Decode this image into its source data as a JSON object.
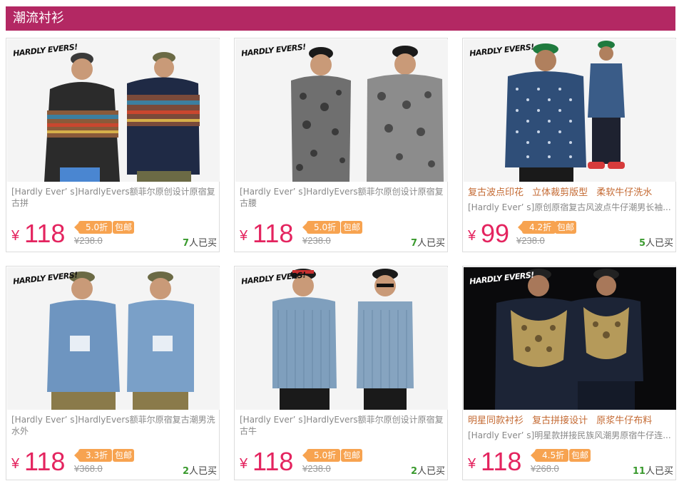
{
  "header": {
    "title": "潮流衬衫"
  },
  "brand": {
    "logo_text": "HARDLY EVERS!"
  },
  "products": [
    {
      "title": "[Hardly Ever’ s]HardlyEvers额菲尔原创设计原宿复古拼",
      "price": "118",
      "currency": "¥",
      "discount": "5.0折",
      "free_shipping": "包邮",
      "original_price": "¥238.0",
      "sold_count": "7",
      "sold_suffix": "人已买",
      "image": "two-models-patchwork-hoodie-jacket"
    },
    {
      "title": "[Hardly Ever’ s]HardlyEvers额菲尔原创设计原宿复古腰",
      "price": "118",
      "currency": "¥",
      "discount": "5.0折",
      "free_shipping": "包邮",
      "original_price": "¥238.0",
      "sold_count": "7",
      "sold_suffix": "人已买",
      "image": "two-models-paisley-shirt"
    },
    {
      "tagline": "复古波点印花 立体裁剪版型 柔软牛仔洗水",
      "title": "[Hardly Ever’ s]原创原宿复古风波点牛仔潮男长袖...",
      "price": "99",
      "currency": "¥",
      "discount": "4.2折",
      "free_shipping": "包邮",
      "original_price": "¥238.0",
      "sold_count": "5",
      "sold_suffix": "人已买",
      "image": "two-models-polka-dot-denim-shirt"
    },
    {
      "title": "[Hardly Ever’ s]HardlyEvers额菲尔原宿复古潮男洗水外",
      "price": "118",
      "currency": "¥",
      "discount": "3.3折",
      "free_shipping": "包邮",
      "original_price": "¥368.0",
      "sold_count": "2",
      "sold_suffix": "人已买",
      "image": "two-models-washed-denim-shirt"
    },
    {
      "title": "[Hardly Ever’ s]HardlyEvers额菲尔原创设计原宿复古牛",
      "price": "118",
      "currency": "¥",
      "discount": "5.0折",
      "free_shipping": "包邮",
      "original_price": "¥238.0",
      "sold_count": "2",
      "sold_suffix": "人已买",
      "image": "two-models-striped-denim-shirt"
    },
    {
      "tagline": "明星同款衬衫 复古拼接设计 原浆牛仔布料",
      "title": "[Hardly Ever’ s]明星款拼接民族风潮男原宿牛仔连...",
      "price": "118",
      "currency": "¥",
      "discount": "4.5折",
      "free_shipping": "包邮",
      "original_price": "¥268.0",
      "sold_count": "11",
      "sold_suffix": "人已买",
      "image": "two-models-embroidered-denim-hoodie"
    }
  ],
  "colors": {
    "header_bg": "#b32863",
    "price": "#e4245f",
    "discount_badge": "#f7a350",
    "sold_count": "#3a9a2e",
    "tagline": "#c46a33"
  }
}
